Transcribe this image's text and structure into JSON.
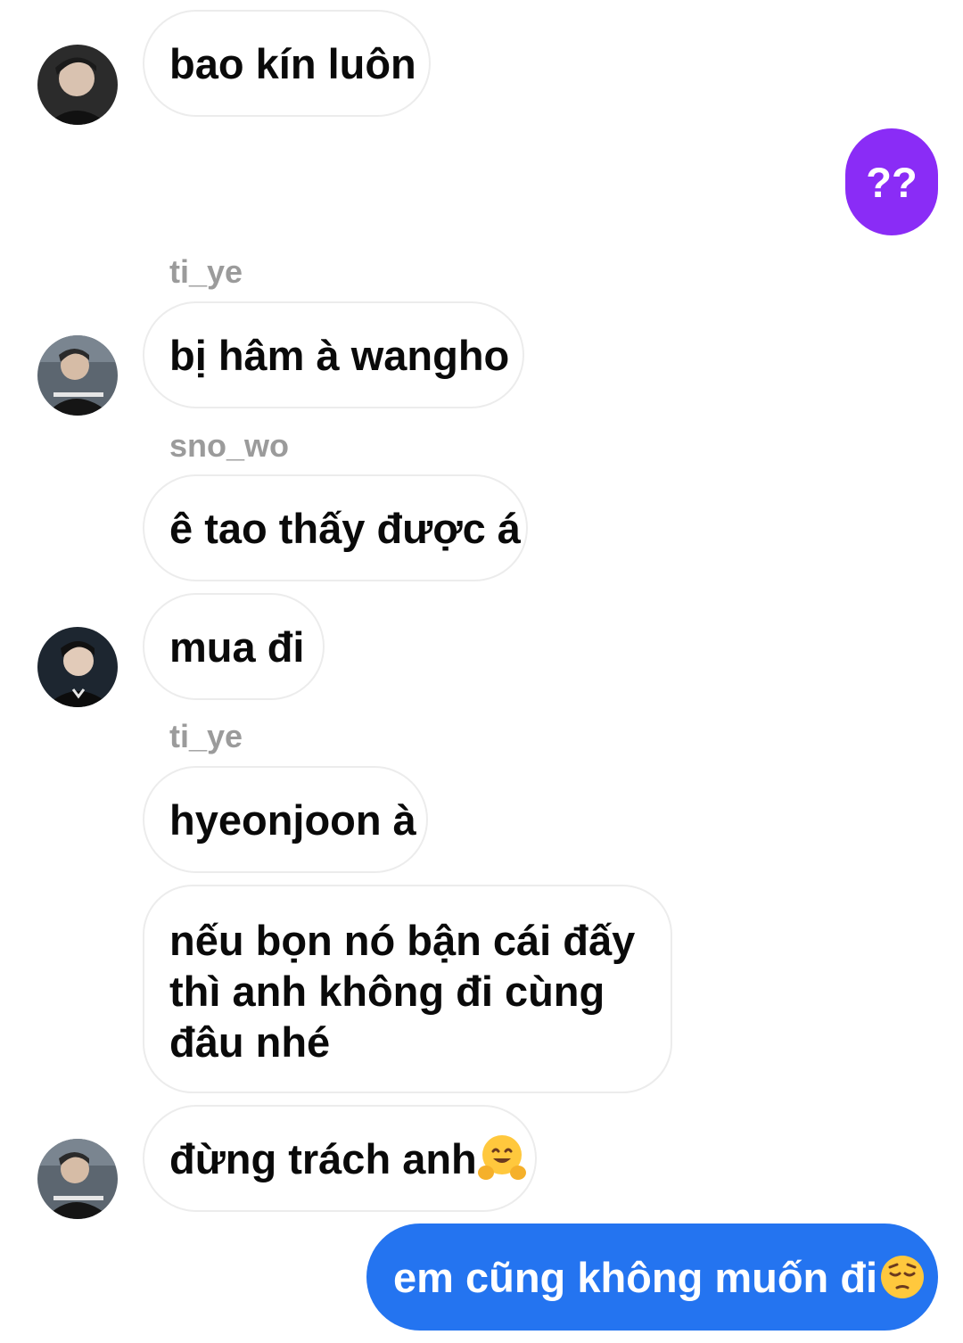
{
  "conversation": {
    "colors": {
      "outgoing_purple": "#8a2cf6",
      "outgoing_blue": "#2474f0",
      "incoming_border": "#ececec",
      "sender_gray": "#9b9b9b"
    },
    "messages": [
      {
        "id": "m1",
        "direction": "incoming",
        "text": "bao kín luôn"
      },
      {
        "id": "m2",
        "direction": "outgoing",
        "text": "??"
      },
      {
        "id": "m3",
        "direction": "incoming",
        "sender": "ti_ye",
        "text": "bị hâm à wangho"
      },
      {
        "id": "m4",
        "direction": "incoming",
        "sender": "sno_wo",
        "text": "ê tao thấy được á"
      },
      {
        "id": "m5",
        "direction": "incoming",
        "text": "mua đi"
      },
      {
        "id": "m6",
        "direction": "incoming",
        "sender": "ti_ye",
        "text": "hyeonjoon à"
      },
      {
        "id": "m7",
        "direction": "incoming",
        "lines": [
          "nếu bọn nó bận cái đấy",
          "thì anh không đi cùng",
          "đâu nhé"
        ]
      },
      {
        "id": "m8",
        "direction": "incoming",
        "text": "đừng trách anh",
        "emoji": "hugging-face-emoji"
      },
      {
        "id": "m9",
        "direction": "outgoing",
        "text": "em cũng không muốn đi",
        "emoji": "pensive-face-emoji"
      }
    ]
  }
}
